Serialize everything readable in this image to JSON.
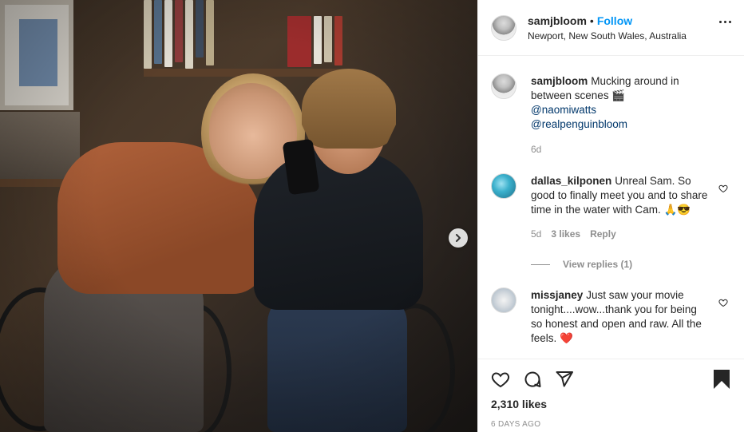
{
  "post": {
    "author": {
      "username": "samjbloom",
      "follow_label": "Follow",
      "separator": "•",
      "location": "Newport, New South Wales, Australia"
    },
    "caption": {
      "username": "samjbloom",
      "text": "Mucking around in between scenes 🎬",
      "mentions": [
        "@naomiwatts",
        "@realpenguinbloom"
      ],
      "time": "6d"
    },
    "comments": [
      {
        "username": "dallas_kilponen",
        "text": "Unreal Sam. So good to finally meet you and to share time in the water with Cam. 🙏😎",
        "time": "5d",
        "likes": "3 likes",
        "reply_label": "Reply",
        "view_replies": "View replies (1)"
      },
      {
        "username": "missjaney",
        "text": "Just saw your movie tonight....wow...thank you for being so honest and open and raw. All the feels. ❤️"
      }
    ],
    "likes_count": "2,310 likes",
    "posted_ago": "6 DAYS AGO"
  },
  "icons": {
    "next": "chevron-right-icon",
    "more": "more-options-icon",
    "like": "heart-icon",
    "comment": "comment-icon",
    "share": "paper-plane-icon",
    "save": "bookmark-icon"
  },
  "colors": {
    "follow": "#0095f6",
    "mention": "#00376b",
    "muted": "#8e8e8e",
    "text": "#262626"
  }
}
